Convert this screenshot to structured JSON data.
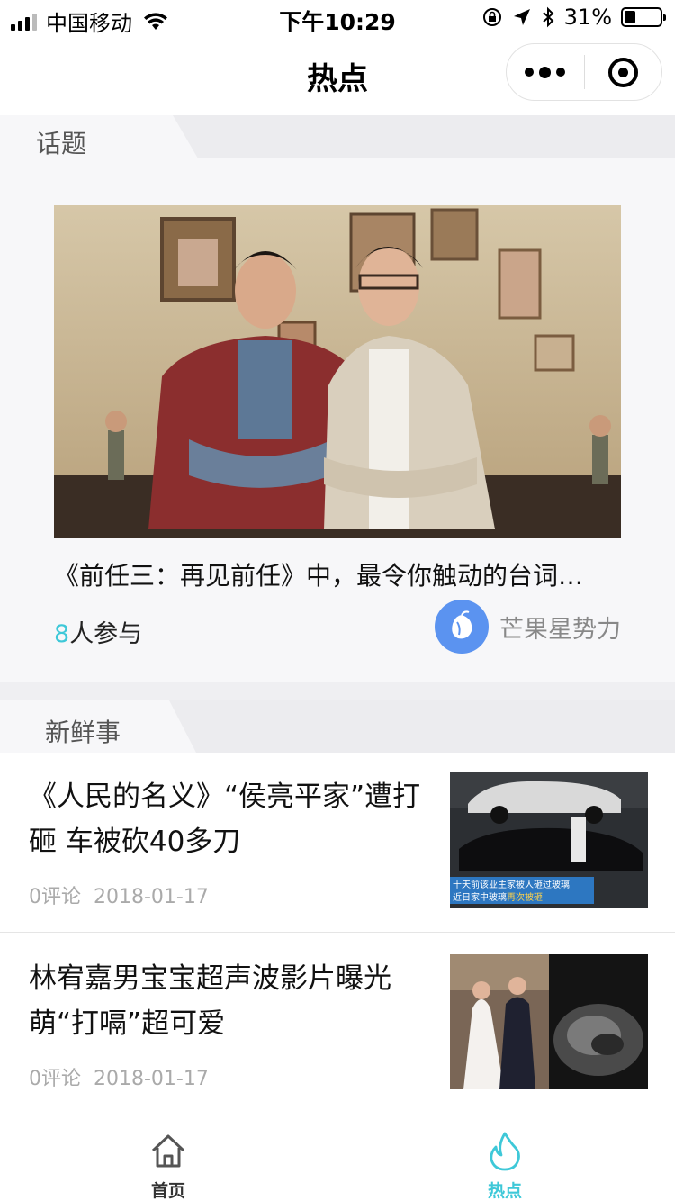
{
  "status_bar": {
    "carrier": "中国移动",
    "time": "下午10:29",
    "battery": "31%",
    "battery_level": 0.31
  },
  "nav": {
    "title": "热点"
  },
  "topic_section": {
    "label": "话题",
    "title": "《前任三：再见前任》中，最令你触动的台词…",
    "participants_count": "8",
    "participants_suffix": "人参与",
    "author": "芒果星势力",
    "author_avatar_color": "#5b93f0"
  },
  "news_section": {
    "label": "新鲜事",
    "items": [
      {
        "title": "《人民的名义》“侯亮平家”遭打砸 车被砍40多刀",
        "comments": "0评论",
        "date": "2018-01-17",
        "thumb_caption_1": "十天前该业主家被人砸过玻璃",
        "thumb_caption_2": "近日家中玻璃",
        "thumb_caption_3": "再次被砸"
      },
      {
        "title": "林宥嘉男宝宝超声波影片曝光 萌“打嗝”超可爱",
        "comments": "0评论",
        "date": "2018-01-17"
      }
    ]
  },
  "tab_bar": {
    "items": [
      {
        "label": "首页",
        "icon": "home-icon"
      },
      {
        "label": "热点",
        "icon": "flame-icon",
        "active": true
      }
    ],
    "active_color": "#3ec8d8"
  }
}
